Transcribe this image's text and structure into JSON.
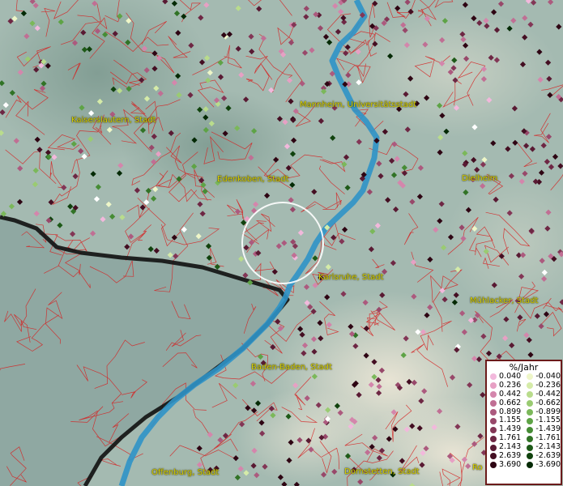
{
  "cities": [
    {
      "name": "Kaiserslautern, Stadt",
      "key": "kaiserslautern"
    },
    {
      "name": "Mannheim, Universitätsstadt",
      "key": "mannheim"
    },
    {
      "name": "Edenkoben, Stadt",
      "key": "edenkoben"
    },
    {
      "name": "Dielheim",
      "key": "dielheim"
    },
    {
      "name": "Karlsruhe, Stadt",
      "key": "karlsruhe"
    },
    {
      "name": "Mühlacker, Stadt",
      "key": "muehlacker"
    },
    {
      "name": "Baden-Baden, Stadt",
      "key": "badenbaden"
    },
    {
      "name": "Offenburg, Stadt",
      "key": "offenburg"
    },
    {
      "name": "Dornstetten, Stadt",
      "key": "dornstetten"
    },
    {
      "name": "Ro",
      "key": "ro"
    }
  ],
  "legend": {
    "title": "%/Jahr",
    "positive": [
      {
        "value": "0.040",
        "color": "#f2b8dc"
      },
      {
        "value": "0.236",
        "color": "#e7a0c4"
      },
      {
        "value": "0.442",
        "color": "#d486ac"
      },
      {
        "value": "0.662",
        "color": "#c06f94"
      },
      {
        "value": "0.899",
        "color": "#ac5a7e"
      },
      {
        "value": "1.155",
        "color": "#98486a"
      },
      {
        "value": "1.439",
        "color": "#833656"
      },
      {
        "value": "1.761",
        "color": "#6e2744"
      },
      {
        "value": "2.143",
        "color": "#591a33"
      },
      {
        "value": "2.639",
        "color": "#440e22"
      },
      {
        "value": "3.690",
        "color": "#2e0513"
      }
    ],
    "negative": [
      {
        "value": "-0.040",
        "color": "#eef6c8"
      },
      {
        "value": "-0.236",
        "color": "#d5eba8"
      },
      {
        "value": "-0.442",
        "color": "#b9dc8c"
      },
      {
        "value": "-0.662",
        "color": "#9acb72"
      },
      {
        "value": "-0.899",
        "color": "#7bb85a"
      },
      {
        "value": "-1.155",
        "color": "#5ea346"
      },
      {
        "value": "-1.439",
        "color": "#468c35"
      },
      {
        "value": "-1.761",
        "color": "#317326"
      },
      {
        "value": "-2.143",
        "color": "#1e5a18"
      },
      {
        "value": "-2.639",
        "color": "#10420d"
      },
      {
        "value": "-3.690",
        "color": "#042a05"
      }
    ]
  },
  "colors": {
    "terrain": "#9fb7ae",
    "border_lines": "#d62020",
    "river": "#2f94c8",
    "state_border": "#111111",
    "city_label": "#d8d000",
    "selection_circle": "#ffffff"
  }
}
